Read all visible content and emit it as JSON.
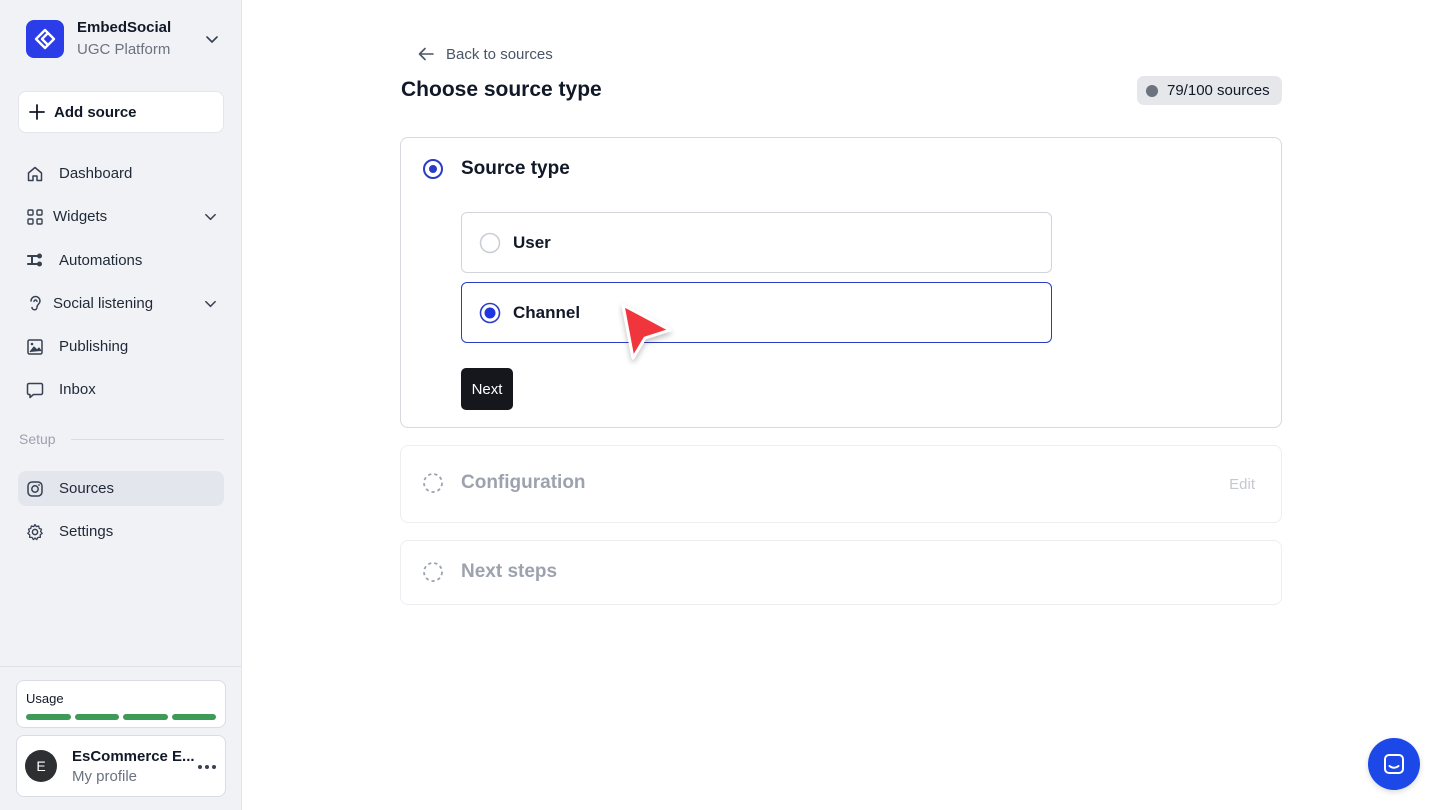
{
  "sidebar": {
    "brand": {
      "name": "EmbedSocial",
      "subtitle": "UGC Platform"
    },
    "add_source_label": "Add source",
    "nav": [
      {
        "label": "Dashboard",
        "icon": "home-icon"
      },
      {
        "label": "Widgets",
        "icon": "grid-icon",
        "has_submenu": true
      },
      {
        "label": "Automations",
        "icon": "automations-icon"
      },
      {
        "label": "Social listening",
        "icon": "ear-icon",
        "has_submenu": true
      },
      {
        "label": "Publishing",
        "icon": "image-icon"
      },
      {
        "label": "Inbox",
        "icon": "chat-bubble-icon"
      }
    ],
    "section_label": "Setup",
    "setup_nav": [
      {
        "label": "Sources",
        "icon": "instagram-icon",
        "active": true
      },
      {
        "label": "Settings",
        "icon": "gear-icon"
      }
    ],
    "usage_label": "Usage",
    "profile": {
      "initial": "E",
      "name": "EsCommerce E...",
      "subtitle": "My profile"
    }
  },
  "main": {
    "back_label": "Back to sources",
    "title": "Choose source type",
    "sources_badge": "79/100 sources",
    "steps": [
      {
        "title": "Source type",
        "options": [
          {
            "label": "User",
            "selected": false
          },
          {
            "label": "Channel",
            "selected": true
          }
        ],
        "next_label": "Next"
      },
      {
        "title": "Configuration",
        "edit_label": "Edit"
      },
      {
        "title": "Next steps"
      }
    ]
  },
  "colors": {
    "accent": "#2b3de8",
    "selected_border": "#2b3dc4",
    "usage_bar": "#3d9a57",
    "cursor": "#f0363c",
    "chat_button": "#1d48e8"
  }
}
